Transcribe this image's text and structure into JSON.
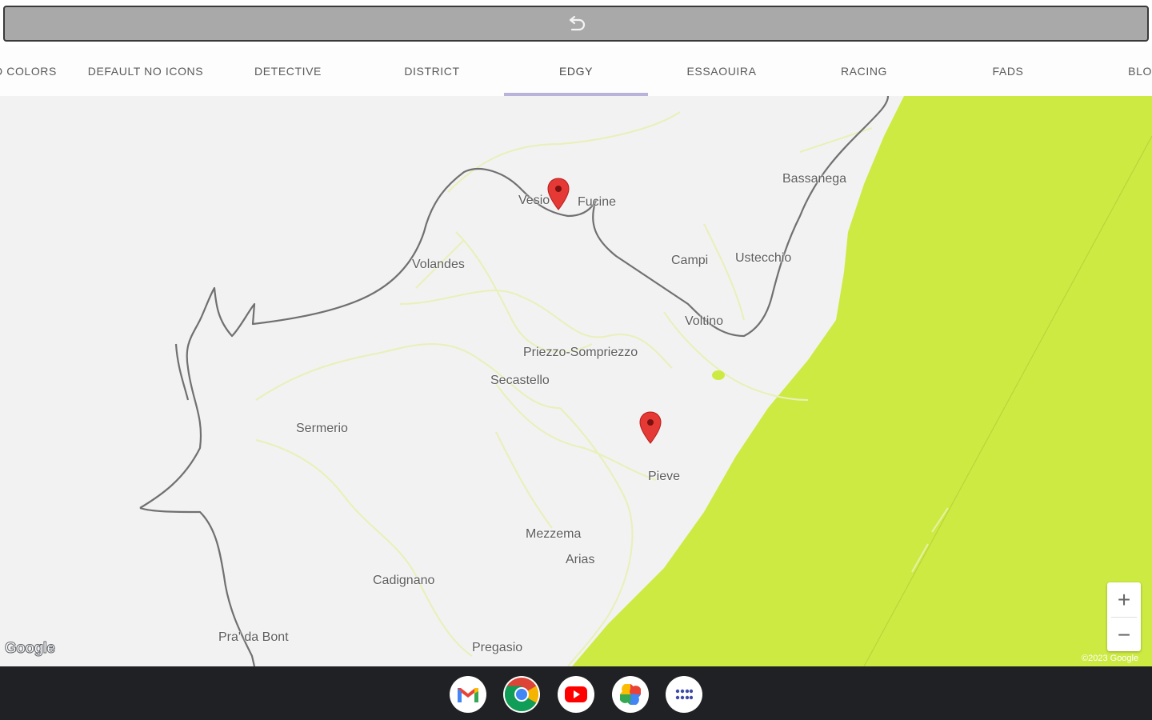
{
  "tabs": [
    {
      "label": "D COLORS",
      "active": false
    },
    {
      "label": "DEFAULT NO ICONS",
      "active": false
    },
    {
      "label": "DETECTIVE",
      "active": false
    },
    {
      "label": "DISTRICT",
      "active": false
    },
    {
      "label": "EDGY",
      "active": true
    },
    {
      "label": "ESSAOUIRA",
      "active": false
    },
    {
      "label": "RACING",
      "active": false
    },
    {
      "label": "FADS",
      "active": false
    },
    {
      "label": "BLO",
      "active": false
    }
  ],
  "map": {
    "places": [
      {
        "name": "Vesio"
      },
      {
        "name": "Fucine"
      },
      {
        "name": "Bassanega"
      },
      {
        "name": "Volandes"
      },
      {
        "name": "Campi"
      },
      {
        "name": "Ustecchio"
      },
      {
        "name": "Voltino"
      },
      {
        "name": "Priezzo-Sompriezzo"
      },
      {
        "name": "Secastello"
      },
      {
        "name": "Sermerio"
      },
      {
        "name": "Pieve"
      },
      {
        "name": "Mezzema"
      },
      {
        "name": "Arias"
      },
      {
        "name": "Cadignano"
      },
      {
        "name": "Pra' da Bont"
      },
      {
        "name": "Pregasio"
      }
    ],
    "water_color": "#cdea43",
    "land_color": "#f2f2f2",
    "road_color": "#e8f0b0",
    "border_color": "#707070",
    "marker_color": "#e53935",
    "zoom_in_label": "+",
    "zoom_out_label": "−",
    "logo_text": "Google",
    "copyright": "©2023 Google"
  },
  "dock": {
    "apps": [
      {
        "name": "Gmail",
        "icon": "gmail-icon"
      },
      {
        "name": "Chrome",
        "icon": "chrome-icon"
      },
      {
        "name": "YouTube",
        "icon": "youtube-icon"
      },
      {
        "name": "Photos",
        "icon": "photos-icon"
      },
      {
        "name": "App launcher",
        "icon": "app-launcher-icon"
      }
    ]
  }
}
